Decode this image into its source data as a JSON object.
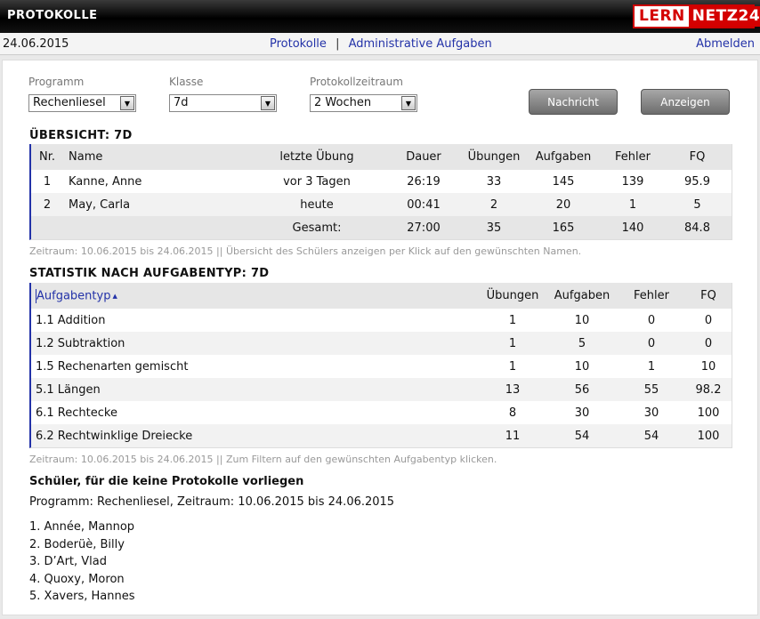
{
  "header": {
    "title": "PROTOKOLLE",
    "logo_left": "LERN",
    "logo_right": "NETZ24"
  },
  "nav": {
    "date": "24.06.2015",
    "link1": "Protokolle",
    "separator": "|",
    "link2": "Administrative Aufgaben",
    "logout": "Abmelden"
  },
  "filters": {
    "programm_label": "Programm",
    "programm_value": "Rechenliesel",
    "klasse_label": "Klasse",
    "klasse_value": "7d",
    "zeitraum_label": "Protokollzeitraum",
    "zeitraum_value": "2 Wochen",
    "nachricht_button": "Nachricht",
    "anzeigen_button": "Anzeigen"
  },
  "overview": {
    "title": "ÜBERSICHT: 7D",
    "headers": [
      "Nr.",
      "Name",
      "letzte Übung",
      "Dauer",
      "Übungen",
      "Aufgaben",
      "Fehler",
      "FQ"
    ],
    "rows": [
      [
        "1",
        "Kanne, Anne",
        "vor 3 Tagen",
        "26:19",
        "33",
        "145",
        "139",
        "95.9"
      ],
      [
        "2",
        "May, Carla",
        "heute",
        "00:41",
        "2",
        "20",
        "1",
        "5"
      ]
    ],
    "total": [
      "Gesamt:",
      "27:00",
      "35",
      "165",
      "140",
      "84.8"
    ],
    "hint": "Zeitraum: 10.06.2015 bis 24.06.2015 || Übersicht des Schülers anzeigen per Klick auf den gewünschten Namen."
  },
  "stats": {
    "title": "STATISTIK NACH AUFGABENTYP: 7D",
    "headers": [
      "Aufgabentyp",
      "Übungen",
      "Aufgaben",
      "Fehler",
      "FQ"
    ],
    "sort_indicator": "▲",
    "rows": [
      [
        "1.1 Addition",
        "1",
        "10",
        "0",
        "0"
      ],
      [
        "1.2 Subtraktion",
        "1",
        "5",
        "0",
        "0"
      ],
      [
        "1.5 Rechenarten gemischt",
        "1",
        "10",
        "1",
        "10"
      ],
      [
        "5.1 Längen",
        "13",
        "56",
        "55",
        "98.2"
      ],
      [
        "6.1 Rechtecke",
        "8",
        "30",
        "30",
        "100"
      ],
      [
        "6.2 Rechtwinklige Dreiecke",
        "11",
        "54",
        "54",
        "100"
      ]
    ],
    "hint": "Zeitraum: 10.06.2015 bis 24.06.2015 || Zum Filtern auf den gewünschten Aufgabentyp klicken."
  },
  "nolog": {
    "title": "Schüler, für die keine Protokolle vorliegen",
    "subtitle": "Programm: Rechenliesel, Zeitraum: 10.06.2015 bis 24.06.2015",
    "students": [
      "1. Année, Mannop",
      "2. Boderüè, Billy",
      "3. D’Art, Vlad",
      "4. Quoxy, Moron",
      "5. Xavers, Hannes"
    ]
  }
}
